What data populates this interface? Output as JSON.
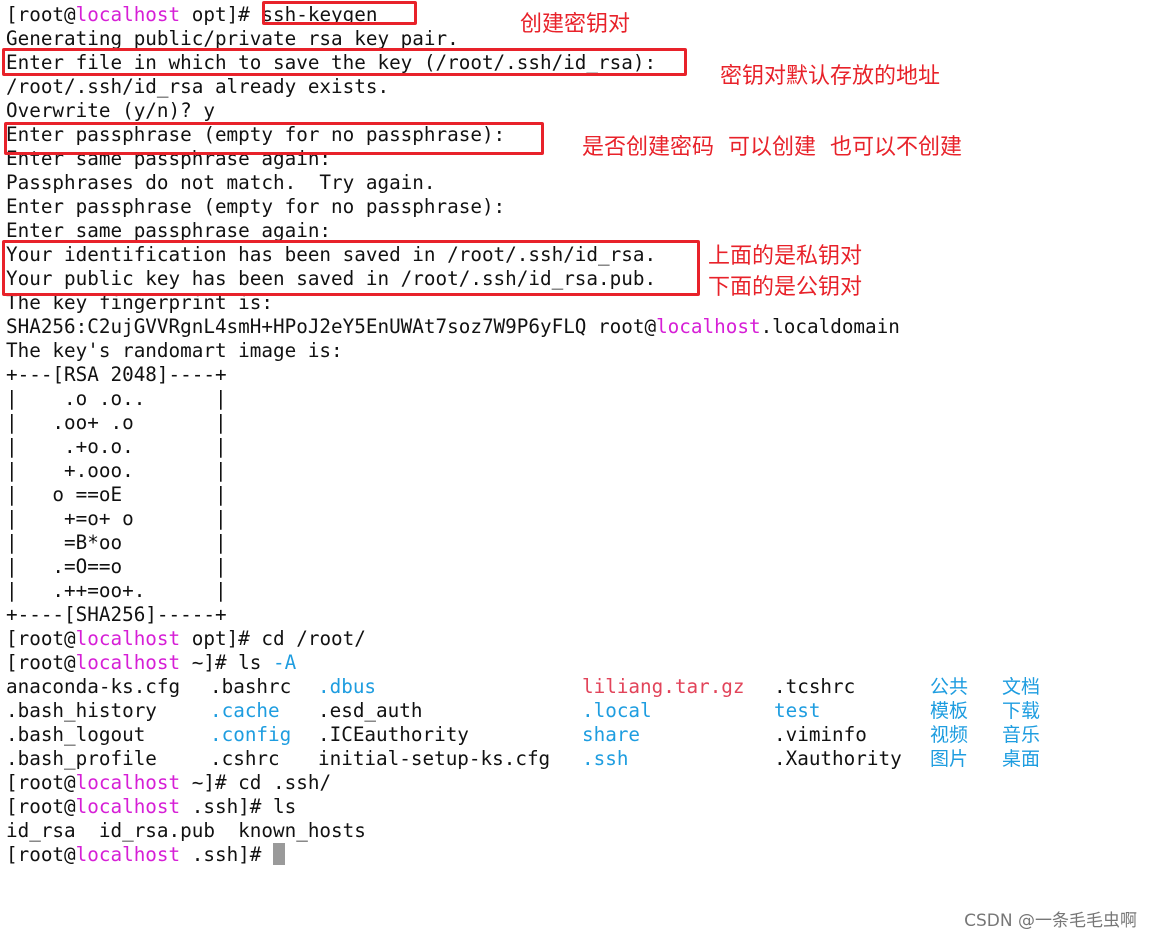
{
  "terminal": {
    "lines": [
      {
        "pre": "[root@",
        "host": "localhost",
        "post": " opt]# ssh-keygen"
      },
      {
        "text": "Generating public/private rsa key pair."
      },
      {
        "text": "Enter file in which to save the key (/root/.ssh/id_rsa):"
      },
      {
        "text": "/root/.ssh/id_rsa already exists."
      },
      {
        "text": "Overwrite (y/n)? y"
      },
      {
        "text": "Enter passphrase (empty for no passphrase):"
      },
      {
        "text": "Enter same passphrase again:"
      },
      {
        "text": "Passphrases do not match.  Try again."
      },
      {
        "text": "Enter passphrase (empty for no passphrase):"
      },
      {
        "text": "Enter same passphrase again:"
      },
      {
        "text": "Your identification has been saved in /root/.ssh/id_rsa."
      },
      {
        "text": "Your public key has been saved in /root/.ssh/id_rsa.pub."
      },
      {
        "text": "The key fingerprint is:"
      },
      {
        "pre": "SHA256:C2ujGVVRgnL4smH+HPoJ2eY5EnUWAt7soz7W9P6yFLQ root@",
        "host": "localhost",
        "post": ".localdomain"
      },
      {
        "text": "The key's randomart image is:"
      },
      {
        "text": "+---[RSA 2048]----+"
      },
      {
        "text": "|    .o .o..      |"
      },
      {
        "text": "|   .oo+ .o       |"
      },
      {
        "text": "|    .+o.o.       |"
      },
      {
        "text": "|    +.ooo.       |"
      },
      {
        "text": "|   o ==oE        |"
      },
      {
        "text": "|    +=o+ o       |"
      },
      {
        "text": "|    =B*oo        |"
      },
      {
        "text": "|   .=O==o        |"
      },
      {
        "text": "|   .++=oo+.      |"
      },
      {
        "text": "+----[SHA256]-----+"
      },
      {
        "pre": "[root@",
        "host": "localhost",
        "post": " opt]# cd /root/"
      },
      {
        "pre": "[root@",
        "host": "localhost",
        "post": " ~]# ls ",
        "flag": "-A"
      }
    ],
    "ls_rows": [
      [
        "anaconda-ks.cfg",
        ".bashrc",
        ".dbus",
        "liliang.tar.gz",
        ".tcshrc",
        "公共",
        "文档"
      ],
      [
        ".bash_history",
        ".cache",
        ".esd_auth",
        ".local",
        "test",
        "模板",
        "下载"
      ],
      [
        ".bash_logout",
        ".config",
        ".ICEauthority",
        "share",
        ".viminfo",
        "视频",
        "音乐"
      ],
      [
        ".bash_profile",
        ".cshrc",
        "initial-setup-ks.cfg",
        ".ssh",
        ".Xauthority",
        "图片",
        "桌面"
      ]
    ],
    "ls_colors": [
      [
        "default",
        "default",
        "dir",
        "archive",
        "default",
        "cjk",
        "cjk"
      ],
      [
        "default",
        "dir",
        "default",
        "dir",
        "dir",
        "cjk",
        "cjk"
      ],
      [
        "default",
        "dir",
        "default",
        "dir",
        "default",
        "cjk",
        "cjk"
      ],
      [
        "default",
        "default",
        "default",
        "dir",
        "default",
        "cjk",
        "cjk"
      ]
    ],
    "after_lines": [
      {
        "pre": "[root@",
        "host": "localhost",
        "post": " ~]# cd .ssh/"
      },
      {
        "pre": "[root@",
        "host": "localhost",
        "post": " .ssh]# ls"
      },
      {
        "text": "id_rsa  id_rsa.pub  known_hosts"
      },
      {
        "pre": "[root@",
        "host": "localhost",
        "post": " .ssh]# ",
        "cursor": true
      }
    ]
  },
  "annotations": {
    "create_keypair": "创建密钥对",
    "default_location": "密钥对默认存放的地址",
    "password_note": "是否创建密码  可以创建  也可以不创建",
    "private_note": "上面的是私钥对",
    "public_note": "下面的是公钥对"
  },
  "watermark": "CSDN @一条毛毛虫啊",
  "colors": {
    "host": "#d61fd6",
    "directory": "#1e9de0",
    "archive": "#e2445a",
    "annotation": "#e8222a",
    "cursor": "#9a9a9a"
  }
}
